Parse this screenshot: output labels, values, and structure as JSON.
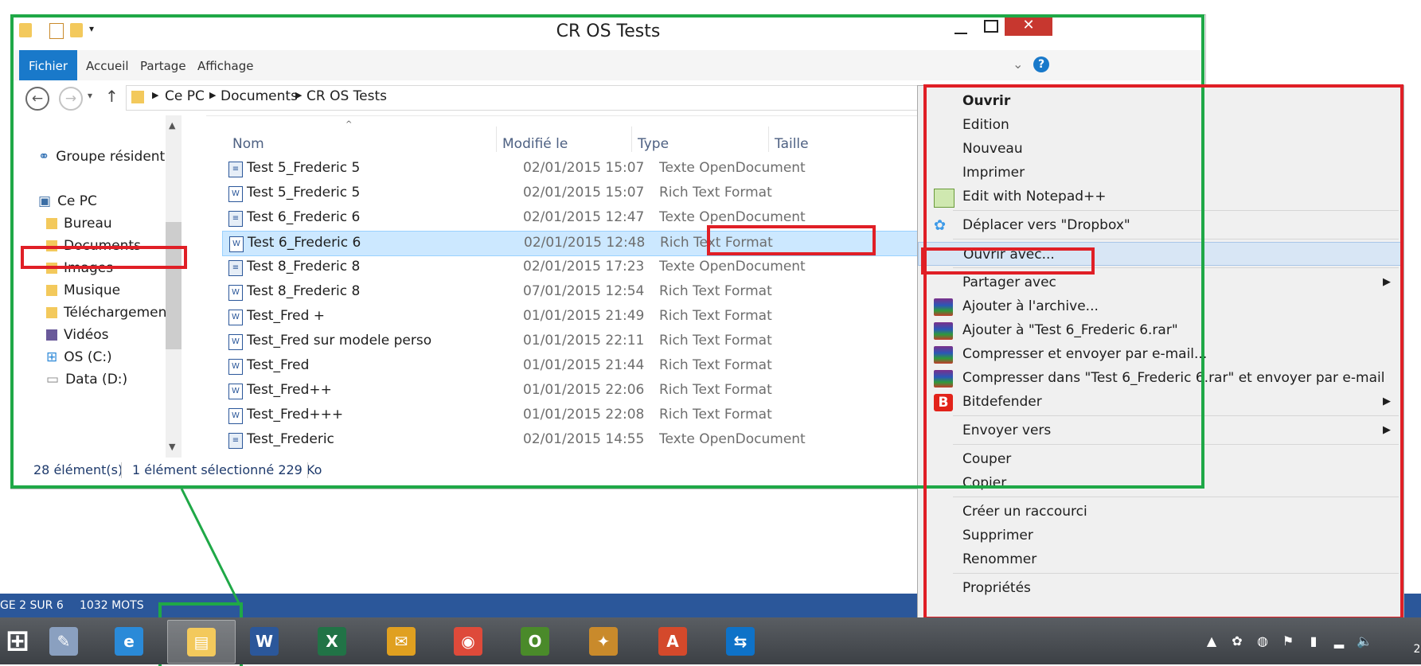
{
  "window": {
    "title": "CR OS Tests",
    "ribbon_tabs": [
      "Fichier",
      "Accueil",
      "Partage",
      "Affichage"
    ],
    "help": "?"
  },
  "address": {
    "crumbs": [
      "Ce PC",
      "Documents",
      "CR OS Tests"
    ]
  },
  "nav": {
    "homegroup": "Groupe résidentiel",
    "this_pc": "Ce PC",
    "items": [
      "Bureau",
      "Documents",
      "Images",
      "Musique",
      "Téléchargements",
      "Vidéos",
      "OS (C:)",
      "Data (D:)"
    ]
  },
  "columns": {
    "name": "Nom",
    "modified": "Modifié le",
    "type": "Type",
    "size": "Taille"
  },
  "files": [
    {
      "name": "Test 5_Frederic 5",
      "date": "02/01/2015 15:07",
      "type": "Texte OpenDocument",
      "icon": "odt-icon"
    },
    {
      "name": "Test 5_Frederic 5",
      "date": "02/01/2015 15:07",
      "type": "Rich Text Format",
      "icon": "word-icon"
    },
    {
      "name": "Test 6_Frederic 6",
      "date": "02/01/2015 12:47",
      "type": "Texte OpenDocument",
      "icon": "odt-icon"
    },
    {
      "name": "Test 6_Frederic 6",
      "date": "02/01/2015 12:48",
      "type": "Rich Text Format",
      "icon": "word-icon",
      "selected": true
    },
    {
      "name": "Test 8_Frederic 8",
      "date": "02/01/2015 17:23",
      "type": "Texte OpenDocument",
      "icon": "odt-icon"
    },
    {
      "name": "Test 8_Frederic 8",
      "date": "07/01/2015 12:54",
      "type": "Rich Text Format",
      "icon": "word-icon"
    },
    {
      "name": "Test_Fred +",
      "date": "01/01/2015 21:49",
      "type": "Rich Text Format",
      "icon": "word-icon"
    },
    {
      "name": "Test_Fred sur modele perso",
      "date": "01/01/2015 22:11",
      "type": "Rich Text Format",
      "icon": "word-icon"
    },
    {
      "name": "Test_Fred",
      "date": "01/01/2015 21:44",
      "type": "Rich Text Format",
      "icon": "word-icon"
    },
    {
      "name": "Test_Fred++",
      "date": "01/01/2015 22:06",
      "type": "Rich Text Format",
      "icon": "word-icon"
    },
    {
      "name": "Test_Fred+++",
      "date": "01/01/2015 22:08",
      "type": "Rich Text Format",
      "icon": "word-icon"
    },
    {
      "name": "Test_Frederic",
      "date": "02/01/2015 14:55",
      "type": "Texte OpenDocument",
      "icon": "odt-icon"
    }
  ],
  "status": {
    "count": "28 élément(s)",
    "selection": "1 élément sélectionné  229 Ko"
  },
  "context_menu": [
    {
      "label": "Ouvrir",
      "bold": true
    },
    {
      "label": "Edition"
    },
    {
      "label": "Nouveau"
    },
    {
      "label": "Imprimer"
    },
    {
      "label": "Edit with Notepad++",
      "icon": "notepadpp-icon"
    },
    {
      "sep": true
    },
    {
      "label": "Déplacer vers \"Dropbox\"",
      "icon": "dropbox-icon"
    },
    {
      "sep": true
    },
    {
      "label": "Ouvrir avec...",
      "highlight": true
    },
    {
      "sep": true
    },
    {
      "label": "Partager avec",
      "submenu": true
    },
    {
      "label": "Ajouter à l'archive...",
      "icon": "winrar-icon"
    },
    {
      "label": "Ajouter à \"Test 6_Frederic 6.rar\"",
      "icon": "winrar-icon"
    },
    {
      "label": "Compresser et envoyer par e-mail...",
      "icon": "winrar-icon"
    },
    {
      "label": "Compresser dans \"Test 6_Frederic 6.rar\" et envoyer par e-mail",
      "icon": "winrar-icon"
    },
    {
      "label": "Bitdefender",
      "icon": "bitdefender-icon",
      "submenu": true
    },
    {
      "sep": true
    },
    {
      "label": "Envoyer vers",
      "submenu": true
    },
    {
      "sep": true
    },
    {
      "label": "Couper"
    },
    {
      "label": "Copier"
    },
    {
      "sep": true
    },
    {
      "label": "Créer un raccourci"
    },
    {
      "label": "Supprimer"
    },
    {
      "label": "Renommer"
    },
    {
      "sep": true
    },
    {
      "label": "Propriétés"
    }
  ],
  "word_status": {
    "page": "GE 2 SUR 6",
    "words": "1032 MOTS"
  },
  "taskbar": {
    "apps": [
      "start-icon",
      "scanner-icon",
      "ie-icon",
      "explorer-icon",
      "word-icon",
      "excel-icon",
      "thunderbird-icon",
      "chrome-icon",
      "opera-icon",
      "paint-icon",
      "acrobat-icon",
      "teamviewer-icon"
    ],
    "clock_partial": "2"
  },
  "colors": {
    "accent": "#1979ca",
    "highlight_red": "#e01f26",
    "highlight_green": "#1fa847",
    "word_blue": "#2b579a",
    "selection": "#cce8ff"
  }
}
